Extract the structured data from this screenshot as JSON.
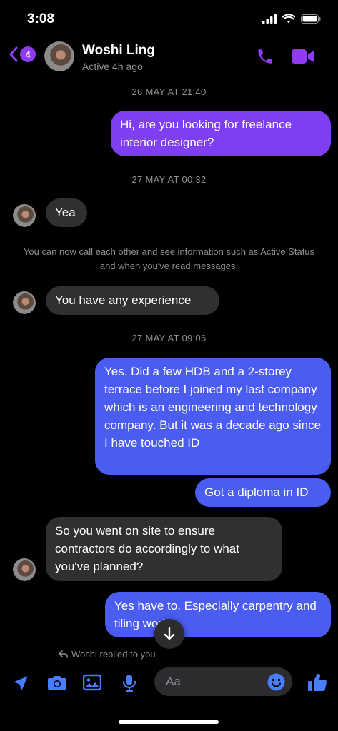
{
  "status_bar": {
    "time": "3:08"
  },
  "header": {
    "back_count": "4",
    "name": "Woshi Ling",
    "status": "Active 4h ago"
  },
  "messages": {
    "ts1": "26 MAY AT 21:40",
    "m1": "Hi, are you looking for freelance interior designer?",
    "ts2": "27 MAY AT 00:32",
    "m2": "Yea",
    "system": "You can now call each other and see information such as Active Status and when you've read messages.",
    "m3": "You have any experience",
    "ts3": "27 MAY AT 09:06",
    "m4": "Yes. Did a few HDB and a 2-storey terrace before I joined my last company which is an engineering and technology company. But it was a decade ago since I have touched ID",
    "m5": "Got a diploma in ID",
    "m6": "So you went on site to ensure contractors do accordingly to what you've planned?",
    "m7": "Yes have to. Especially carpentry and tiling works"
  },
  "reply_note": "Woshi replied to you",
  "composer": {
    "placeholder": "Aa"
  },
  "colors": {
    "accent": "#8e3bf3",
    "bubble_purple": "#7e3ff2",
    "bubble_blue": "#4b5cf0",
    "bubble_incoming": "#303030",
    "composer_icon": "#4a7cff"
  },
  "icons": [
    "back-chevron-icon",
    "phone-icon",
    "video-camera-icon",
    "location-arrow-icon",
    "camera-icon",
    "image-icon",
    "microphone-icon",
    "emoji-icon",
    "thumbs-up-icon",
    "arrow-down-icon",
    "reply-icon"
  ]
}
